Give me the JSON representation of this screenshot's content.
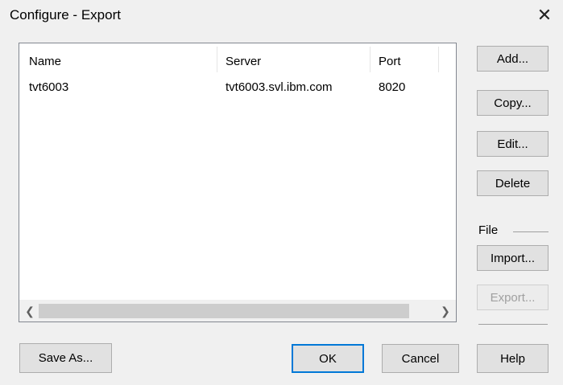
{
  "window": {
    "title": "Configure - Export",
    "close_glyph": "✕"
  },
  "table": {
    "columns": [
      "Name",
      "Server",
      "Port"
    ],
    "rows": [
      {
        "name": "tvt6003",
        "server": "tvt6003.svl.ibm.com",
        "port": "8020"
      }
    ],
    "scroll_left_glyph": "❮",
    "scroll_right_glyph": "❯"
  },
  "side_buttons": {
    "add": "Add...",
    "copy": "Copy...",
    "edit": "Edit...",
    "delete": "Delete",
    "file_group_label": "File",
    "import": "Import...",
    "export": "Export..."
  },
  "footer": {
    "save_as": "Save As...",
    "ok": "OK",
    "cancel": "Cancel",
    "help": "Help"
  },
  "colors": {
    "default_button_border": "#0078d7",
    "button_face": "#e1e1e1"
  }
}
